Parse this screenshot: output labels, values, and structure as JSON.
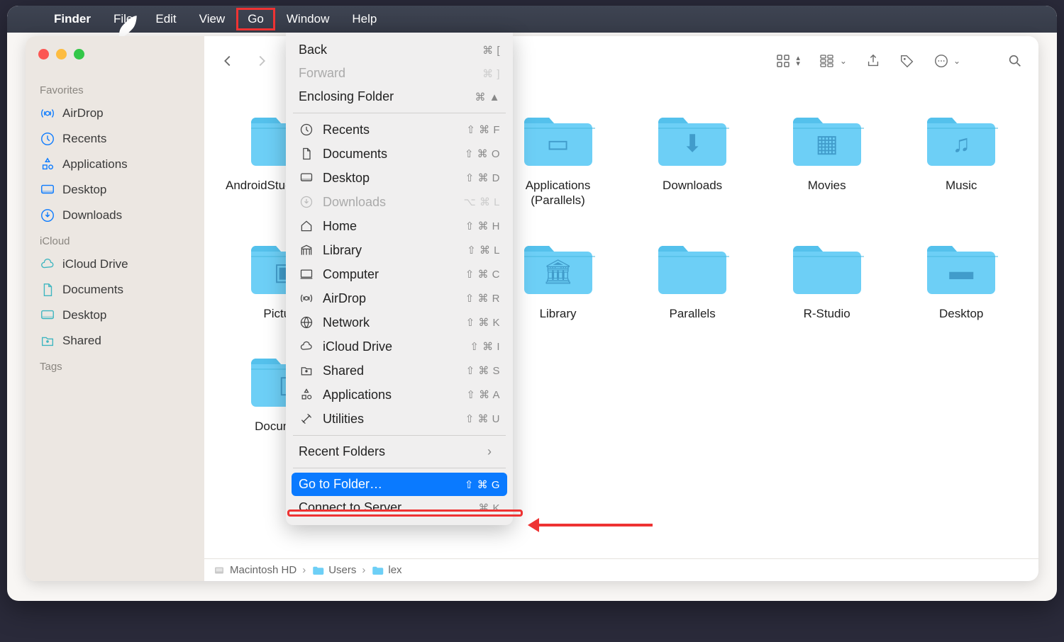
{
  "menubar": {
    "app": "Finder",
    "items": [
      "File",
      "Edit",
      "View",
      "Go",
      "Window",
      "Help"
    ]
  },
  "sidebar": {
    "sections": [
      {
        "title": "Favorites",
        "items": [
          {
            "icon": "airdrop",
            "label": "AirDrop"
          },
          {
            "icon": "clock",
            "label": "Recents"
          },
          {
            "icon": "apps",
            "label": "Applications"
          },
          {
            "icon": "desktop",
            "label": "Desktop"
          },
          {
            "icon": "download",
            "label": "Downloads"
          }
        ]
      },
      {
        "title": "iCloud",
        "items": [
          {
            "icon": "cloud",
            "label": "iCloud Drive",
            "cyan": true
          },
          {
            "icon": "document",
            "label": "Documents",
            "cyan": true
          },
          {
            "icon": "desktop",
            "label": "Desktop",
            "cyan": true
          },
          {
            "icon": "shared",
            "label": "Shared",
            "cyan": true
          }
        ]
      },
      {
        "title": "Tags",
        "items": []
      }
    ]
  },
  "folders": [
    {
      "name": "AndroidStudioProjects",
      "mark": ""
    },
    {
      "name": "",
      "mark": ""
    },
    {
      "name": "Applications\n(Parallels)",
      "mark": "app"
    },
    {
      "name": "Downloads",
      "mark": "download"
    },
    {
      "name": "Movies",
      "mark": "movie"
    },
    {
      "name": "Music",
      "mark": "music"
    },
    {
      "name": "Pictures",
      "mark": "picture"
    },
    {
      "name": "",
      "mark": ""
    },
    {
      "name": "Library",
      "mark": "library"
    },
    {
      "name": "Parallels",
      "mark": ""
    },
    {
      "name": "R-Studio",
      "mark": ""
    },
    {
      "name": "Desktop",
      "mark": "desktop"
    },
    {
      "name": "Documents",
      "mark": "document"
    }
  ],
  "dropdown": [
    {
      "label": "Back",
      "shortcut": "⌘ [",
      "icon": ""
    },
    {
      "label": "Forward",
      "shortcut": "⌘ ]",
      "icon": "",
      "dim": true
    },
    {
      "label": "Enclosing Folder",
      "shortcut": "⌘ ▲",
      "icon": ""
    },
    {
      "sep": true
    },
    {
      "label": "Recents",
      "shortcut": "⇧ ⌘ F",
      "icon": "clock"
    },
    {
      "label": "Documents",
      "shortcut": "⇧ ⌘ O",
      "icon": "document"
    },
    {
      "label": "Desktop",
      "shortcut": "⇧ ⌘ D",
      "icon": "desktop"
    },
    {
      "label": "Downloads",
      "shortcut": "⌥ ⌘ L",
      "icon": "download",
      "dim": true
    },
    {
      "label": "Home",
      "shortcut": "⇧ ⌘ H",
      "icon": "home"
    },
    {
      "label": "Library",
      "shortcut": "⇧ ⌘ L",
      "icon": "library"
    },
    {
      "label": "Computer",
      "shortcut": "⇧ ⌘ C",
      "icon": "computer"
    },
    {
      "label": "AirDrop",
      "shortcut": "⇧ ⌘ R",
      "icon": "airdrop"
    },
    {
      "label": "Network",
      "shortcut": "⇧ ⌘ K",
      "icon": "network"
    },
    {
      "label": "iCloud Drive",
      "shortcut": "⇧ ⌘ I",
      "icon": "cloud"
    },
    {
      "label": "Shared",
      "shortcut": "⇧ ⌘ S",
      "icon": "shared"
    },
    {
      "label": "Applications",
      "shortcut": "⇧ ⌘ A",
      "icon": "apps"
    },
    {
      "label": "Utilities",
      "shortcut": "⇧ ⌘ U",
      "icon": "utilities"
    },
    {
      "sep": true
    },
    {
      "label": "Recent Folders",
      "shortcut": "",
      "icon": "",
      "chev": true
    },
    {
      "sep": true
    },
    {
      "label": "Go to Folder…",
      "shortcut": "⇧ ⌘ G",
      "icon": "",
      "sel": true
    },
    {
      "label": "Connect to Server…",
      "shortcut": "⌘ K",
      "icon": ""
    }
  ],
  "pathbar": {
    "segments": [
      "Macintosh HD",
      "Users",
      "lex"
    ]
  }
}
